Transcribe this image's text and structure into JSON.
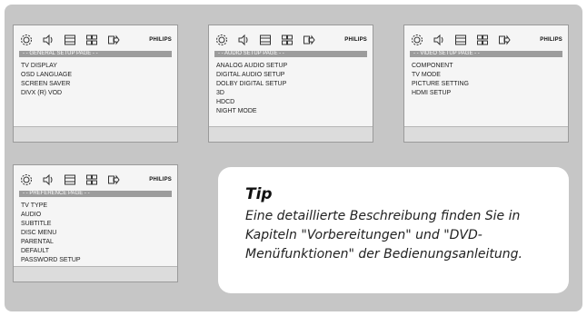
{
  "brand": "PHILIPS",
  "icons": [
    "gear-icon",
    "speaker-icon",
    "screen-icon",
    "grid-icon",
    "exit-icon"
  ],
  "panels": [
    {
      "page_label": "- - GENERAL SETUP PAGE - -",
      "items": [
        "TV DISPLAY",
        "OSD LANGUAGE",
        "SCREEN SAVER",
        "DIVX (R) VOD"
      ]
    },
    {
      "page_label": "- - AUDIO SETUP PAGE - -",
      "items": [
        "ANALOG AUDIO SETUP",
        "DIGITAL AUDIO SETUP",
        "DOLBY DIGITAL SETUP",
        "3D",
        "HDCD",
        "NIGHT MODE"
      ]
    },
    {
      "page_label": "- - VIDEO SETUP PAGE - -",
      "items": [
        "COMPONENT",
        "TV MODE",
        "PICTURE SETTING",
        "HDMI SETUP"
      ]
    },
    {
      "page_label": "- - PREFERENCE PAGE - -",
      "items": [
        "TV TYPE",
        "AUDIO",
        "SUBTITLE",
        "DISC MENU",
        "PARENTAL",
        "DEFAULT",
        "PASSWORD SETUP"
      ]
    }
  ],
  "tip": {
    "title": "Tip",
    "body_lines": [
      "Eine detaillierte Beschreibung finden Sie in",
      "Kapiteln \"Vorbereitungen\" und \"DVD-",
      "Menüfunktionen\" der Bedienungsanleitung."
    ]
  }
}
